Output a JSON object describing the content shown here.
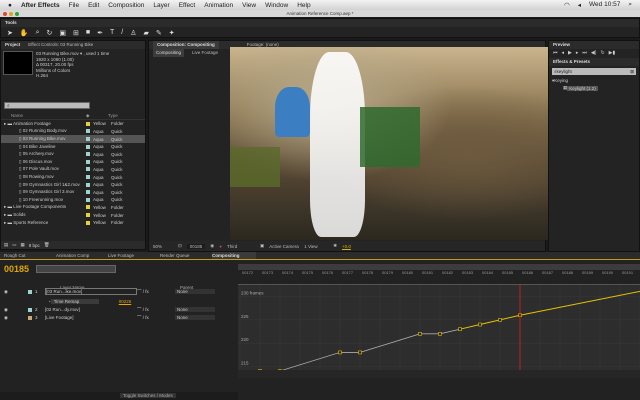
{
  "menubar": {
    "app": "After Effects",
    "items": [
      "File",
      "Edit",
      "Composition",
      "Layer",
      "Effect",
      "Animation",
      "View",
      "Window",
      "Help"
    ],
    "clock": "Wed 10:57"
  },
  "window_title": "Animation Reference Comp.aep *",
  "tools": {
    "title": "Tools"
  },
  "project": {
    "tab": "Project",
    "tab2": "Effect Controls: 03 Running Bike",
    "selected_name": "03 Running Bike.mov ▾ , used 1 time",
    "info": [
      "1920 x 1080 (1.00)",
      "Δ 00317, 20.00 fps",
      "Millions of Colors",
      "H.264"
    ],
    "columns": [
      "Name",
      "Type"
    ],
    "items": [
      {
        "name": "Animation Footage",
        "label": "Yellow",
        "type": "Folder",
        "color": "#e6d13a",
        "indent": 0
      },
      {
        "name": "02 Running Body.mov",
        "label": "Aqua",
        "type": "Quick",
        "color": "#9fd4cc",
        "indent": 1
      },
      {
        "name": "03 Running Bike.mov",
        "label": "Aqua",
        "type": "Quick",
        "color": "#9fd4cc",
        "indent": 1,
        "selected": true
      },
      {
        "name": "04 Bike Javeline",
        "label": "Aqua",
        "type": "Quick",
        "color": "#9fd4cc",
        "indent": 1
      },
      {
        "name": "05 Archery.mov",
        "label": "Aqua",
        "type": "Quick",
        "color": "#9fd4cc",
        "indent": 1
      },
      {
        "name": "06 Discus.mov",
        "label": "Aqua",
        "type": "Quick",
        "color": "#9fd4cc",
        "indent": 1
      },
      {
        "name": "07 Pole Vault.mov",
        "label": "Aqua",
        "type": "Quick",
        "color": "#9fd4cc",
        "indent": 1
      },
      {
        "name": "08 Rowing.mov",
        "label": "Aqua",
        "type": "Quick",
        "color": "#9fd4cc",
        "indent": 1
      },
      {
        "name": "09 Gymnastics Girl 1&2.mov",
        "label": "Aqua",
        "type": "Quick",
        "color": "#9fd4cc",
        "indent": 1
      },
      {
        "name": "09 Gymnastics Girl 3.mov",
        "label": "Aqua",
        "type": "Quick",
        "color": "#9fd4cc",
        "indent": 1
      },
      {
        "name": "10 Freerunning.mov",
        "label": "Aqua",
        "type": "Quick",
        "color": "#9fd4cc",
        "indent": 1
      },
      {
        "name": "Live Footage Components",
        "label": "Yellow",
        "type": "Folder",
        "color": "#e6d13a",
        "indent": 0
      },
      {
        "name": "Solids",
        "label": "Yellow",
        "type": "Folder",
        "color": "#e6d13a",
        "indent": 0
      },
      {
        "name": "Sports Reference",
        "label": "Yellow",
        "type": "Folder",
        "color": "#e6d13a",
        "indent": 0
      }
    ],
    "bpc": "8 bpc"
  },
  "comp": {
    "tab": "Composition: Compositing",
    "tab2": "Footage: (none)",
    "crumbs": [
      "Compositing",
      "Live Footage"
    ],
    "zoom": "50%",
    "timecode": "00185",
    "resolution": "Third",
    "camera": "Active Camera",
    "views": "1 View",
    "exposure": "+0.0"
  },
  "preview": {
    "tab": "Preview"
  },
  "effects": {
    "tab": "Effects & Presets",
    "search": "keylight",
    "category": "Keying",
    "result": "Keylight (1.2)"
  },
  "timeline": {
    "tabs": [
      "Rough Cut",
      "Animation Comp",
      "Live Footage",
      "Render Queue",
      "Compositing"
    ],
    "timecode": "00185",
    "columns": [
      "Layer Name",
      "Parent"
    ],
    "layers": [
      {
        "num": "1",
        "name": "[03 Run...ike.mov]",
        "parent": "None",
        "color": "#9fd4cc"
      },
      {
        "num": "2",
        "name": "[02 Run...dy.mov]",
        "parent": "None",
        "color": "#9fd4cc"
      },
      {
        "num": "3",
        "name": "[Live Footage]",
        "parent": "None",
        "color": "#c8a878"
      }
    ],
    "time_remap": {
      "label": "Time Remap",
      "value": "00226"
    },
    "toggle": "Toggle Switches / Modes"
  },
  "chart_data": {
    "type": "line",
    "title": "Time Remap value graph",
    "ylabel": "frames",
    "y_ticks": [
      "230 frames",
      "225",
      "220",
      "215"
    ],
    "ylim": [
      212.5,
      232.5
    ],
    "x_ticks": [
      "00172",
      "00173",
      "00174",
      "00175",
      "00176",
      "00177",
      "00178",
      "00179",
      "00180",
      "00181",
      "00182",
      "00183",
      "00184",
      "00185",
      "00186",
      "00187",
      "00188",
      "00189",
      "00190",
      "00191"
    ],
    "x": [
      172.5,
      173.5,
      176.5,
      177.5,
      180.5,
      181.5,
      182.5,
      183.5,
      184.5,
      185.5,
      191.7
    ],
    "values": [
      214,
      214,
      218,
      218,
      222,
      222,
      223,
      224,
      225,
      226,
      231.3
    ],
    "current_time": 185.5,
    "accent": "#e6c200",
    "playhead": "#e0201a"
  }
}
